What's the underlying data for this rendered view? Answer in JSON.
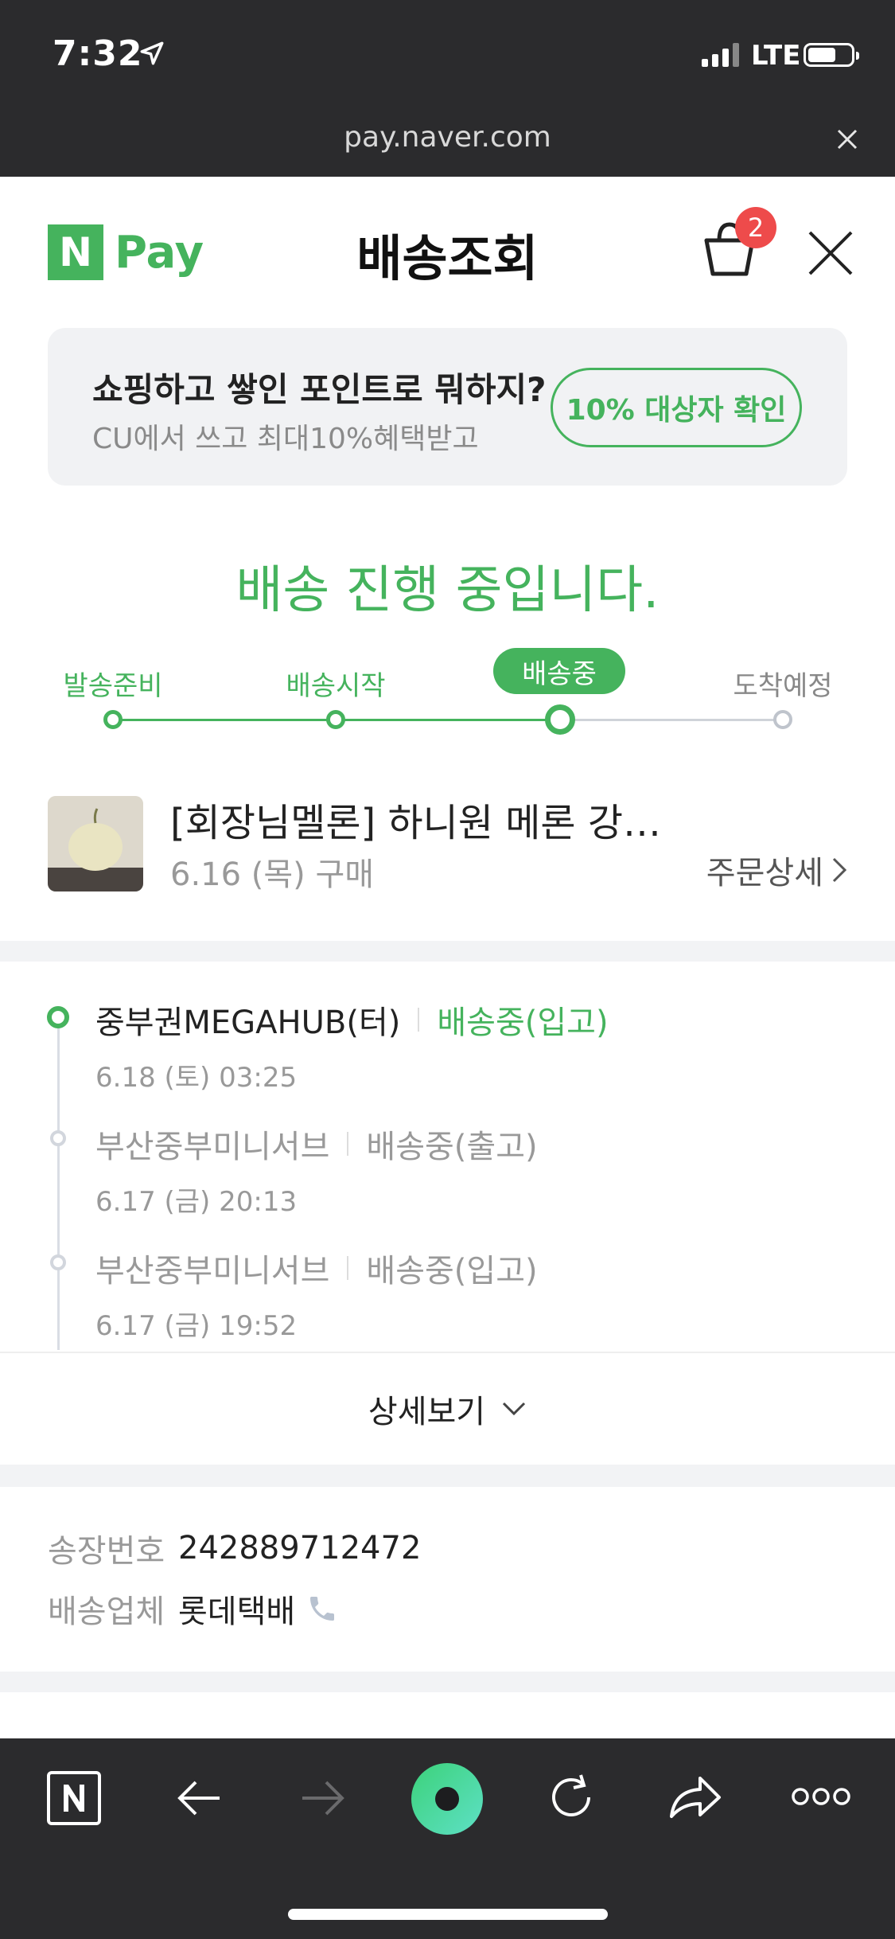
{
  "status_bar": {
    "time": "7:32",
    "network": "LTE"
  },
  "browser": {
    "url": "pay.naver.com"
  },
  "header": {
    "logo_mark": "N",
    "logo_text": "Pay",
    "title": "배송조회",
    "cart_count": "2"
  },
  "banner": {
    "title": "쇼핑하고 쌓인 포인트로 뭐하지?",
    "subtitle": "CU에서 쓰고 최대10%혜택받고",
    "button_label": "10% 대상자 확인"
  },
  "progress": {
    "headline": "배송 진행 중입니다.",
    "steps": [
      {
        "label": "발송준비",
        "state": "done"
      },
      {
        "label": "배송시작",
        "state": "done"
      },
      {
        "label": "배송중",
        "state": "current"
      },
      {
        "label": "도착예정",
        "state": "todo"
      }
    ]
  },
  "product": {
    "name": "[회장님멜론] 하니원 메론 강…",
    "purchase_date": "6.16 (목) 구매",
    "order_detail_label": "주문상세"
  },
  "tracking": [
    {
      "place": "중부권MEGAHUB(터)",
      "status": "배송중(입고)",
      "time": "6.18 (토) 03:25",
      "active": true
    },
    {
      "place": "부산중부미니서브",
      "status": "배송중(출고)",
      "time": "6.17 (금) 20:13",
      "active": false
    },
    {
      "place": "부산중부미니서브",
      "status": "배송중(입고)",
      "time": "6.17 (금) 19:52",
      "active": false
    }
  ],
  "more_label": "상세보기",
  "shipment": {
    "invoice_label": "송장번호",
    "invoice_number": "242889712472",
    "carrier_label": "배송업체",
    "carrier_name": "롯데택배"
  },
  "colors": {
    "accent": "#45b35d",
    "badge": "#ee4b4b",
    "dark_bar": "#2b2b2d"
  }
}
